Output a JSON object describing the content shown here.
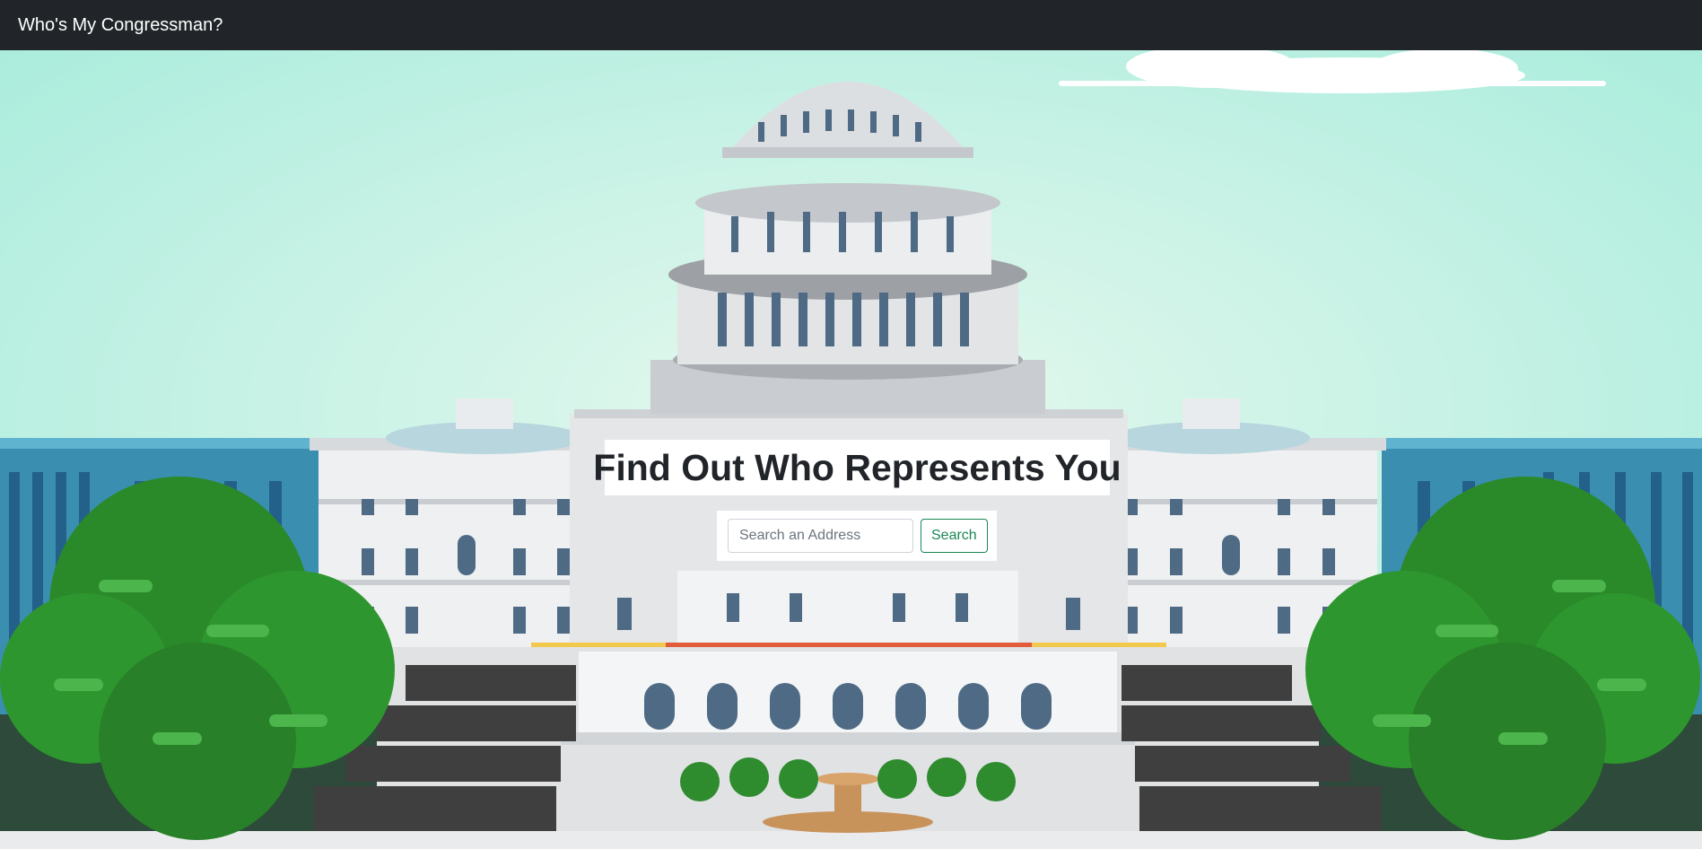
{
  "navbar": {
    "brand": "Who's My Congressman?"
  },
  "hero": {
    "heading": "Find Out Who Represents You",
    "illustration": "capitol-building-illustration"
  },
  "search": {
    "placeholder": "Search an Address",
    "value": "",
    "button_label": "Search"
  },
  "colors": {
    "navbar_bg": "#212529",
    "sky": "#b6efdf",
    "search_button": "#198754",
    "tree_green": "#2e8b2e"
  }
}
